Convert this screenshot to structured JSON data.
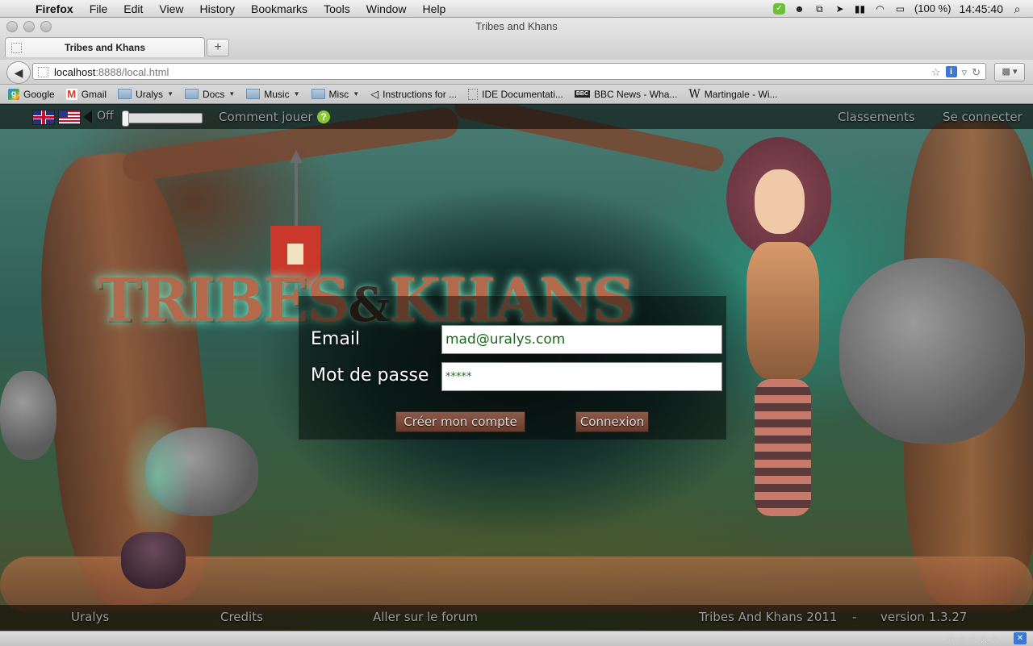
{
  "menubar": {
    "app": "Firefox",
    "items": [
      "File",
      "Edit",
      "View",
      "History",
      "Bookmarks",
      "Tools",
      "Window",
      "Help"
    ],
    "battery": "(100 %)",
    "clock": "14:45:40"
  },
  "window": {
    "title": "Tribes and Khans"
  },
  "tab": {
    "label": "Tribes and Khans",
    "new_tab": "+"
  },
  "url": {
    "host": "localhost",
    "rest": ":8888/local.html"
  },
  "bookmarks": [
    {
      "label": "Google",
      "icon": "google-icon"
    },
    {
      "label": "Gmail",
      "icon": "gmail-icon"
    },
    {
      "label": "Uralys",
      "icon": "folder-icon",
      "dropdown": true
    },
    {
      "label": "Docs",
      "icon": "folder-icon",
      "dropdown": true
    },
    {
      "label": "Music",
      "icon": "folder-icon",
      "dropdown": true
    },
    {
      "label": "Misc",
      "icon": "folder-icon",
      "dropdown": true
    },
    {
      "label": "Instructions for ...",
      "icon": "unity-icon"
    },
    {
      "label": "IDE Documentati...",
      "icon": "page-icon"
    },
    {
      "label": "BBC News - Wha...",
      "icon": "bbc-icon"
    },
    {
      "label": "Martingale - Wi...",
      "icon": "wikipedia-icon"
    }
  ],
  "game": {
    "top": {
      "sound_state": "Off",
      "volume": 0,
      "how_to_play": "Comment jouer",
      "rankings": "Classements",
      "login": "Se connecter"
    },
    "logo": {
      "text_a": "TRIBES",
      "amp": "&",
      "text_b": "KHANS"
    },
    "form": {
      "email_label": "Email",
      "email_value": "mad@uralys.com",
      "password_label": "Mot de passe",
      "password_value": "*****",
      "create_button": "Créer mon compte",
      "login_button": "Connexion"
    },
    "footer": {
      "uralys": "Uralys",
      "credits": "Credits",
      "forum": "Aller sur le forum",
      "copyright": "Tribes And Khans 2011",
      "separator": "-",
      "version": "version 1.3.27"
    }
  },
  "statusbar": {
    "stars": "☆☆☆☆☆"
  }
}
